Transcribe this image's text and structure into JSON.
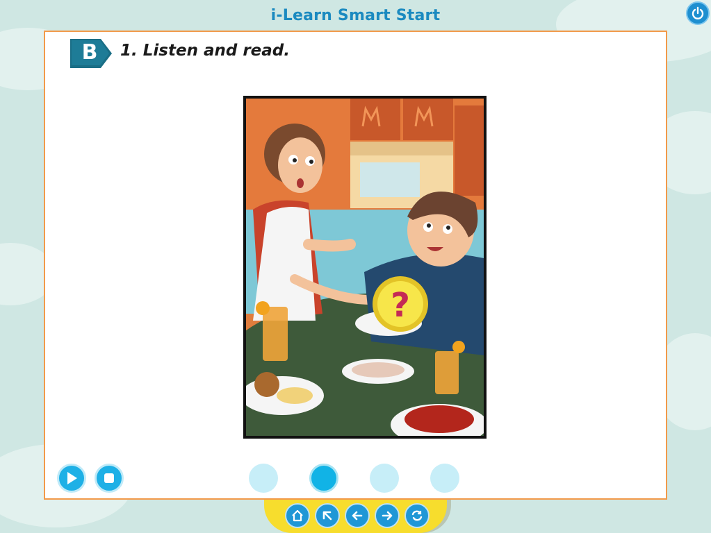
{
  "app": {
    "title": "i-Learn Smart Start"
  },
  "lesson": {
    "section_letter": "B",
    "instruction": "1. Listen and read."
  },
  "colors": {
    "background": "#cfe7e3",
    "title": "#1b8ac0",
    "panel_border": "#f29a4a",
    "badge": "#1a6e86",
    "control": "#1eb0e6",
    "navbar": "#f7dd2d"
  },
  "illustration": {
    "description": "mother serving food to boy at kitchen table",
    "question_mark": "?"
  },
  "audio_controls": [
    {
      "name": "play-button",
      "icon": "play-icon"
    },
    {
      "name": "stop-button",
      "icon": "stop-icon"
    }
  ],
  "pagination": {
    "total": 4,
    "active_index": 2
  },
  "nav": [
    {
      "name": "home-button",
      "icon": "home-icon"
    },
    {
      "name": "menu-button",
      "icon": "arrow-up-left-icon"
    },
    {
      "name": "back-button",
      "icon": "arrow-left-icon"
    },
    {
      "name": "next-button",
      "icon": "arrow-right-icon"
    },
    {
      "name": "replay-button",
      "icon": "refresh-icon"
    }
  ]
}
